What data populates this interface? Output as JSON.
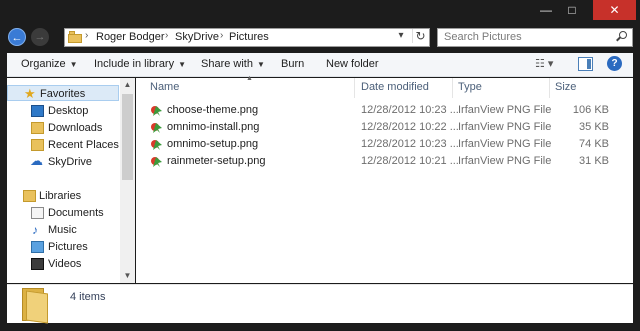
{
  "window": {
    "minimize_glyph": "—",
    "maximize_glyph": "□",
    "close_glyph": "✕"
  },
  "address": {
    "crumbs": [
      "Roger Bodger",
      "SkyDrive",
      "Pictures"
    ],
    "separator": "›",
    "search_placeholder": "Search Pictures"
  },
  "commands": {
    "organize": "Organize",
    "include_in_library": "Include in library",
    "share_with": "Share with",
    "burn": "Burn",
    "new_folder": "New folder"
  },
  "nav": {
    "favorites_header": "Favorites",
    "favorites": [
      "Desktop",
      "Downloads",
      "Recent Places",
      "SkyDrive"
    ],
    "libraries_header": "Libraries",
    "libraries": [
      "Documents",
      "Music",
      "Pictures",
      "Videos"
    ]
  },
  "columns": {
    "name": "Name",
    "date": "Date modified",
    "type": "Type",
    "size": "Size"
  },
  "files": [
    {
      "name": "choose-theme.png",
      "date": "12/28/2012 10:23 ...",
      "type": "IrfanView PNG File",
      "size": "106 KB"
    },
    {
      "name": "omnimo-install.png",
      "date": "12/28/2012 10:22 ...",
      "type": "IrfanView PNG File",
      "size": "35 KB"
    },
    {
      "name": "omnimo-setup.png",
      "date": "12/28/2012 10:23 ...",
      "type": "IrfanView PNG File",
      "size": "74 KB"
    },
    {
      "name": "rainmeter-setup.png",
      "date": "12/28/2012 10:21 ...",
      "type": "IrfanView PNG File",
      "size": "31 KB"
    }
  ],
  "details": {
    "item_count": "4 items"
  },
  "colors": {
    "accent": "#3a7bd5",
    "close": "#c7312a",
    "selection": "#dceaf7"
  }
}
